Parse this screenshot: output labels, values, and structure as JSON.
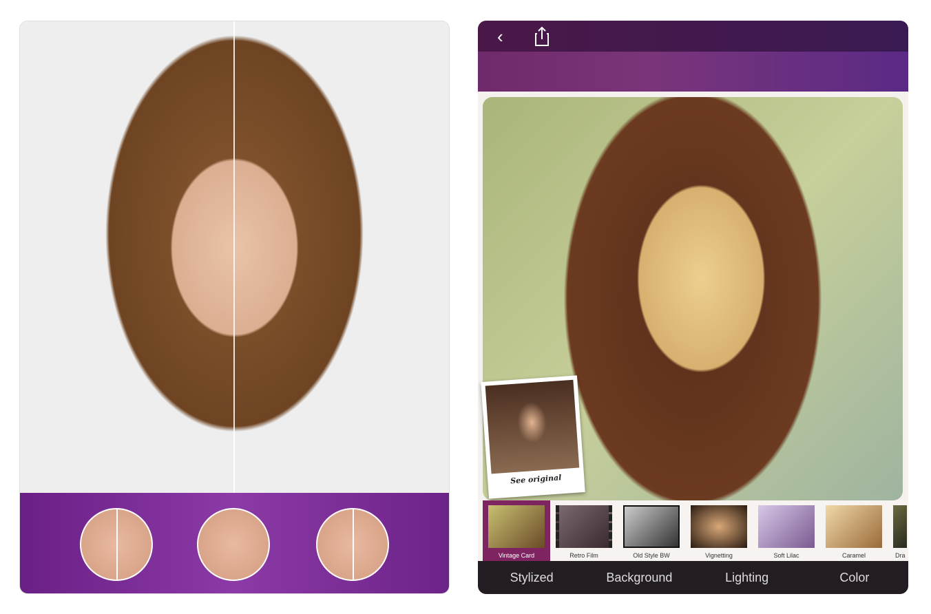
{
  "left_panel": {
    "comparison_circles": [
      "smile-closeup",
      "skin-closeup",
      "eye-closeup"
    ],
    "accent": "#7a2c96"
  },
  "right_panel": {
    "header": {
      "back_icon": "chevron-left-icon",
      "share_icon": "share-icon"
    },
    "see_original_label": "See original",
    "filters": [
      {
        "label": "Vintage Card",
        "selected": true
      },
      {
        "label": "Retro Film"
      },
      {
        "label": "Old Style BW"
      },
      {
        "label": "Vignetting"
      },
      {
        "label": "Soft Lilac"
      },
      {
        "label": "Caramel"
      },
      {
        "label": "Dra"
      }
    ],
    "tabs": [
      "Stylized",
      "Background",
      "Lighting",
      "Color"
    ],
    "selected_color": "#7e2460"
  }
}
